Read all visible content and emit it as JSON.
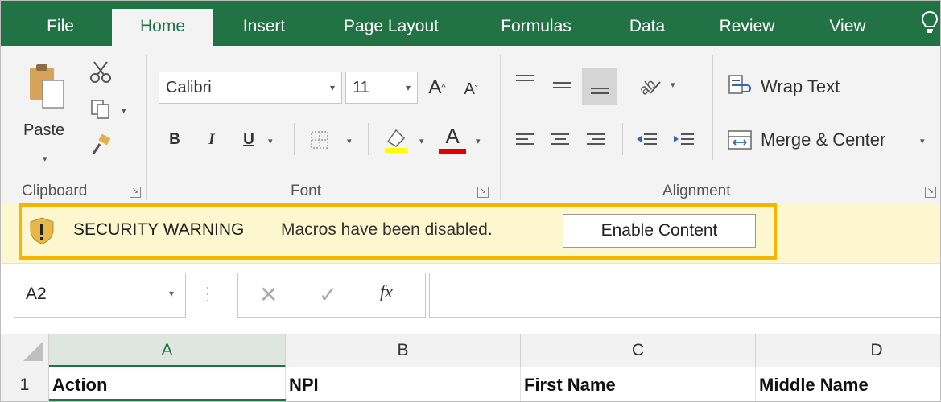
{
  "ribbon_tabs": [
    {
      "label": "File"
    },
    {
      "label": "Home"
    },
    {
      "label": "Insert"
    },
    {
      "label": "Page Layout"
    },
    {
      "label": "Formulas"
    },
    {
      "label": "Data"
    },
    {
      "label": "Review"
    },
    {
      "label": "View"
    }
  ],
  "active_tab": "Home",
  "clipboard": {
    "paste_label": "Paste",
    "group_label": "Clipboard"
  },
  "font": {
    "family": "Calibri",
    "size": "11",
    "bold": "B",
    "italic": "I",
    "underline": "U",
    "font_color_glyph": "A",
    "group_label": "Font"
  },
  "alignment": {
    "wrap_text_label": "Wrap Text",
    "merge_center_label": "Merge & Center",
    "group_label": "Alignment"
  },
  "security_bar": {
    "title": "SECURITY WARNING",
    "message": "Macros have been disabled.",
    "button_label": "Enable Content"
  },
  "formula_bar": {
    "name_box": "A2",
    "fx_label": "fx",
    "value": ""
  },
  "grid": {
    "columns": [
      "A",
      "B",
      "C",
      "D"
    ],
    "selected_column": "A",
    "rows": [
      {
        "number": "1",
        "cells": [
          "Action",
          "NPI",
          "First Name",
          "Middle Name"
        ]
      }
    ]
  },
  "colors": {
    "excel_green": "#217346",
    "warning_yellow": "#fdf7cf",
    "highlight_border": "#f4b400"
  }
}
